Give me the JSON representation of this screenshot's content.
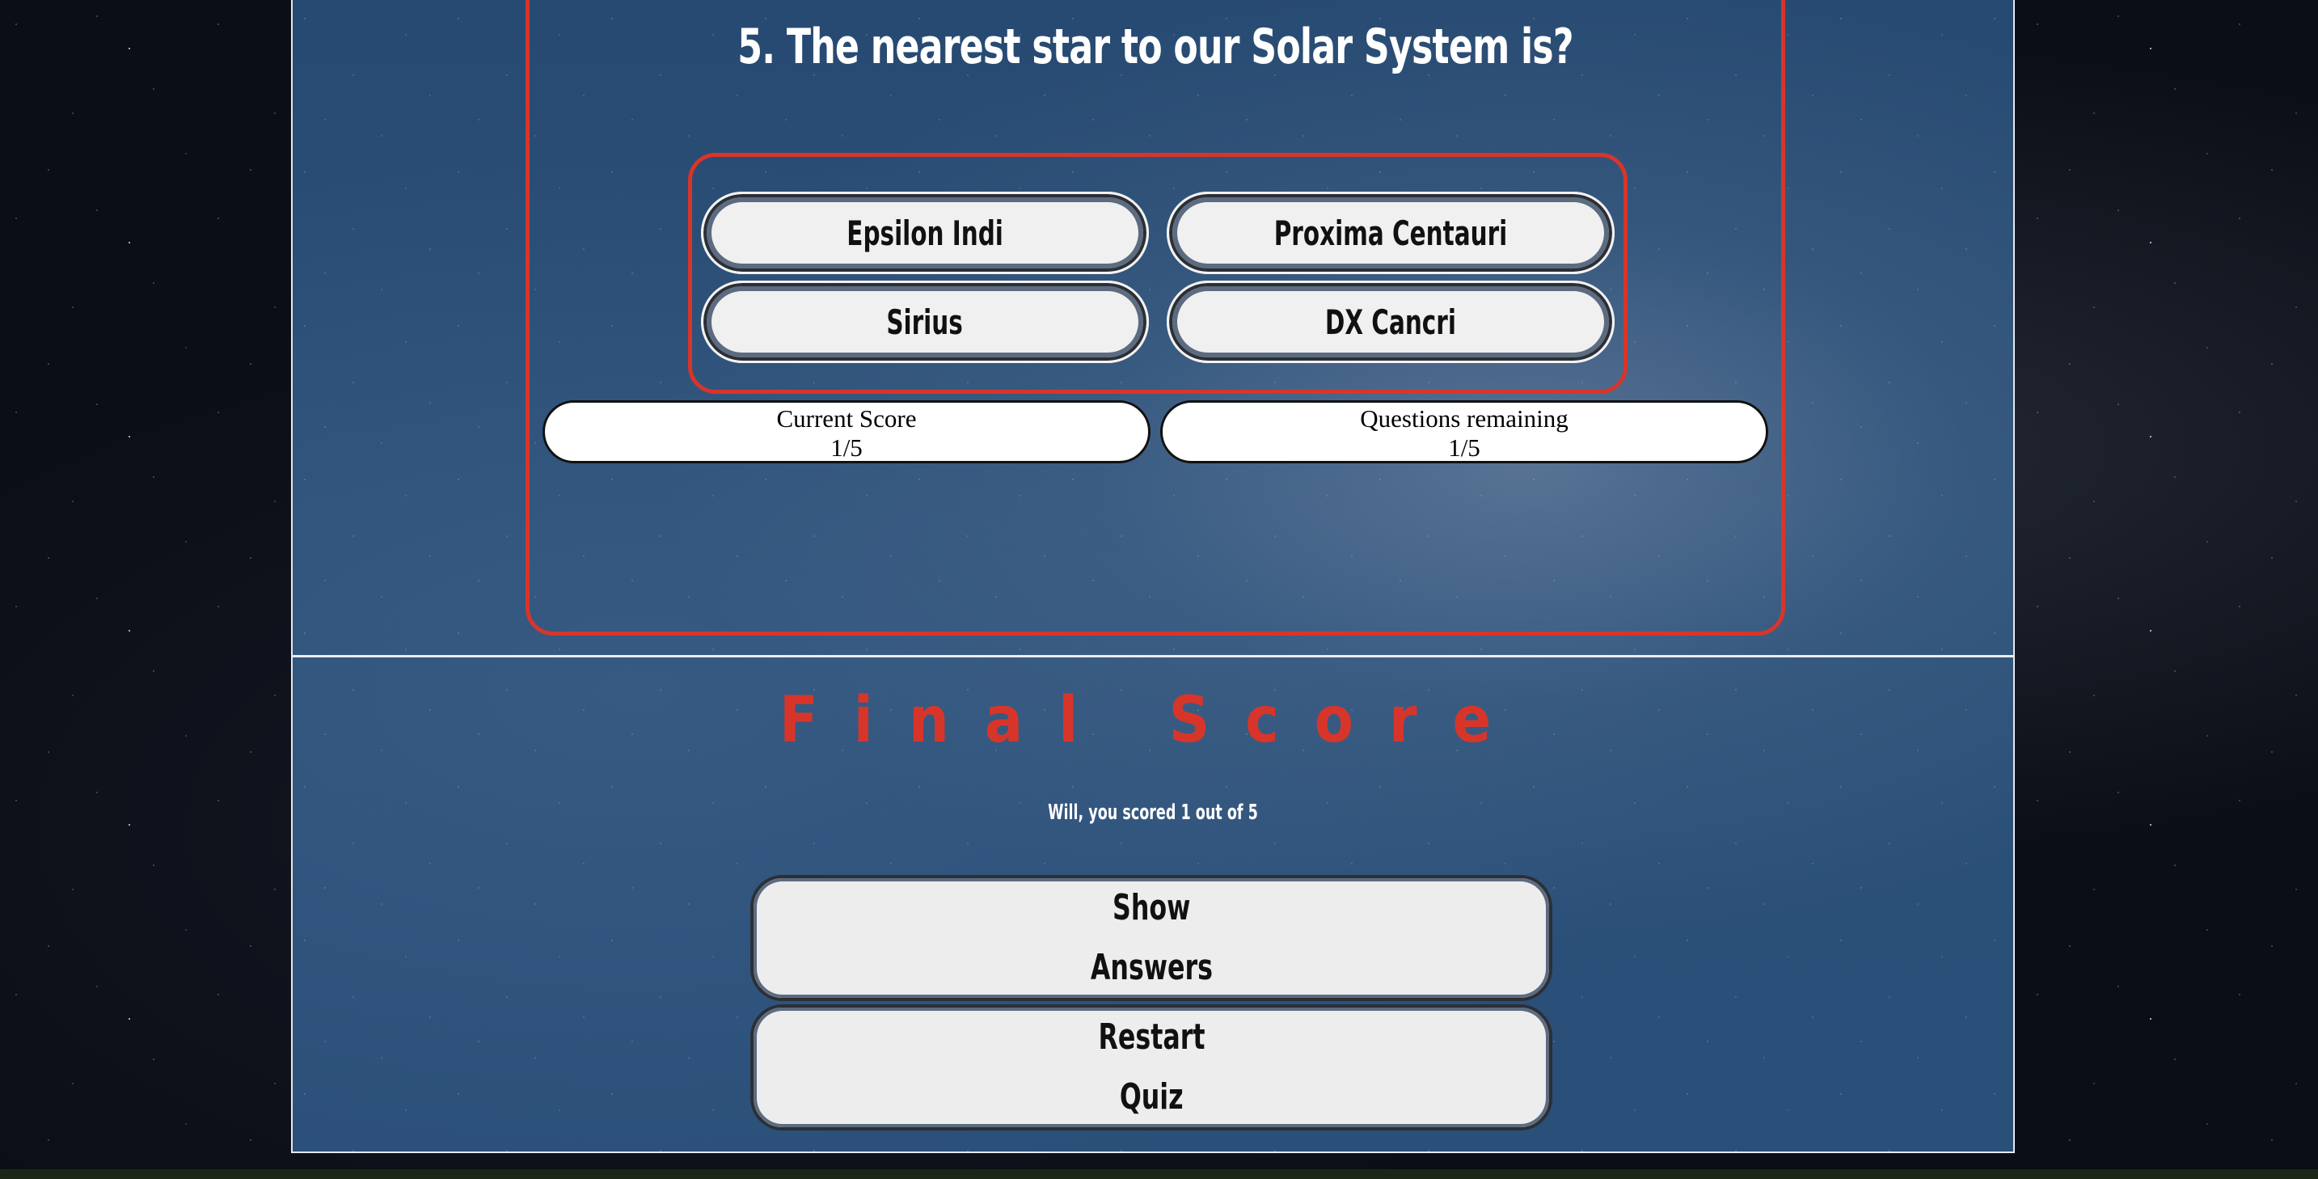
{
  "quiz": {
    "question": "5. The nearest star to our Solar System is?",
    "answers": [
      "Epsilon Indi",
      "Proxima Centauri",
      "Sirius",
      "DX Cancri"
    ],
    "score": {
      "label": "Current Score",
      "value": "1/5"
    },
    "remaining": {
      "label": "Questions remaining",
      "value": "1/5"
    }
  },
  "final": {
    "title": "Final Score",
    "message": "Will, you scored 1 out of 5",
    "show_answers": {
      "line1": "Show",
      "line2": "Answers"
    },
    "restart": {
      "line1": "Restart",
      "line2": "Quiz"
    }
  },
  "colors": {
    "accent": "#d8352a",
    "panel": "#2b5078",
    "button": "#f0f0f0"
  }
}
